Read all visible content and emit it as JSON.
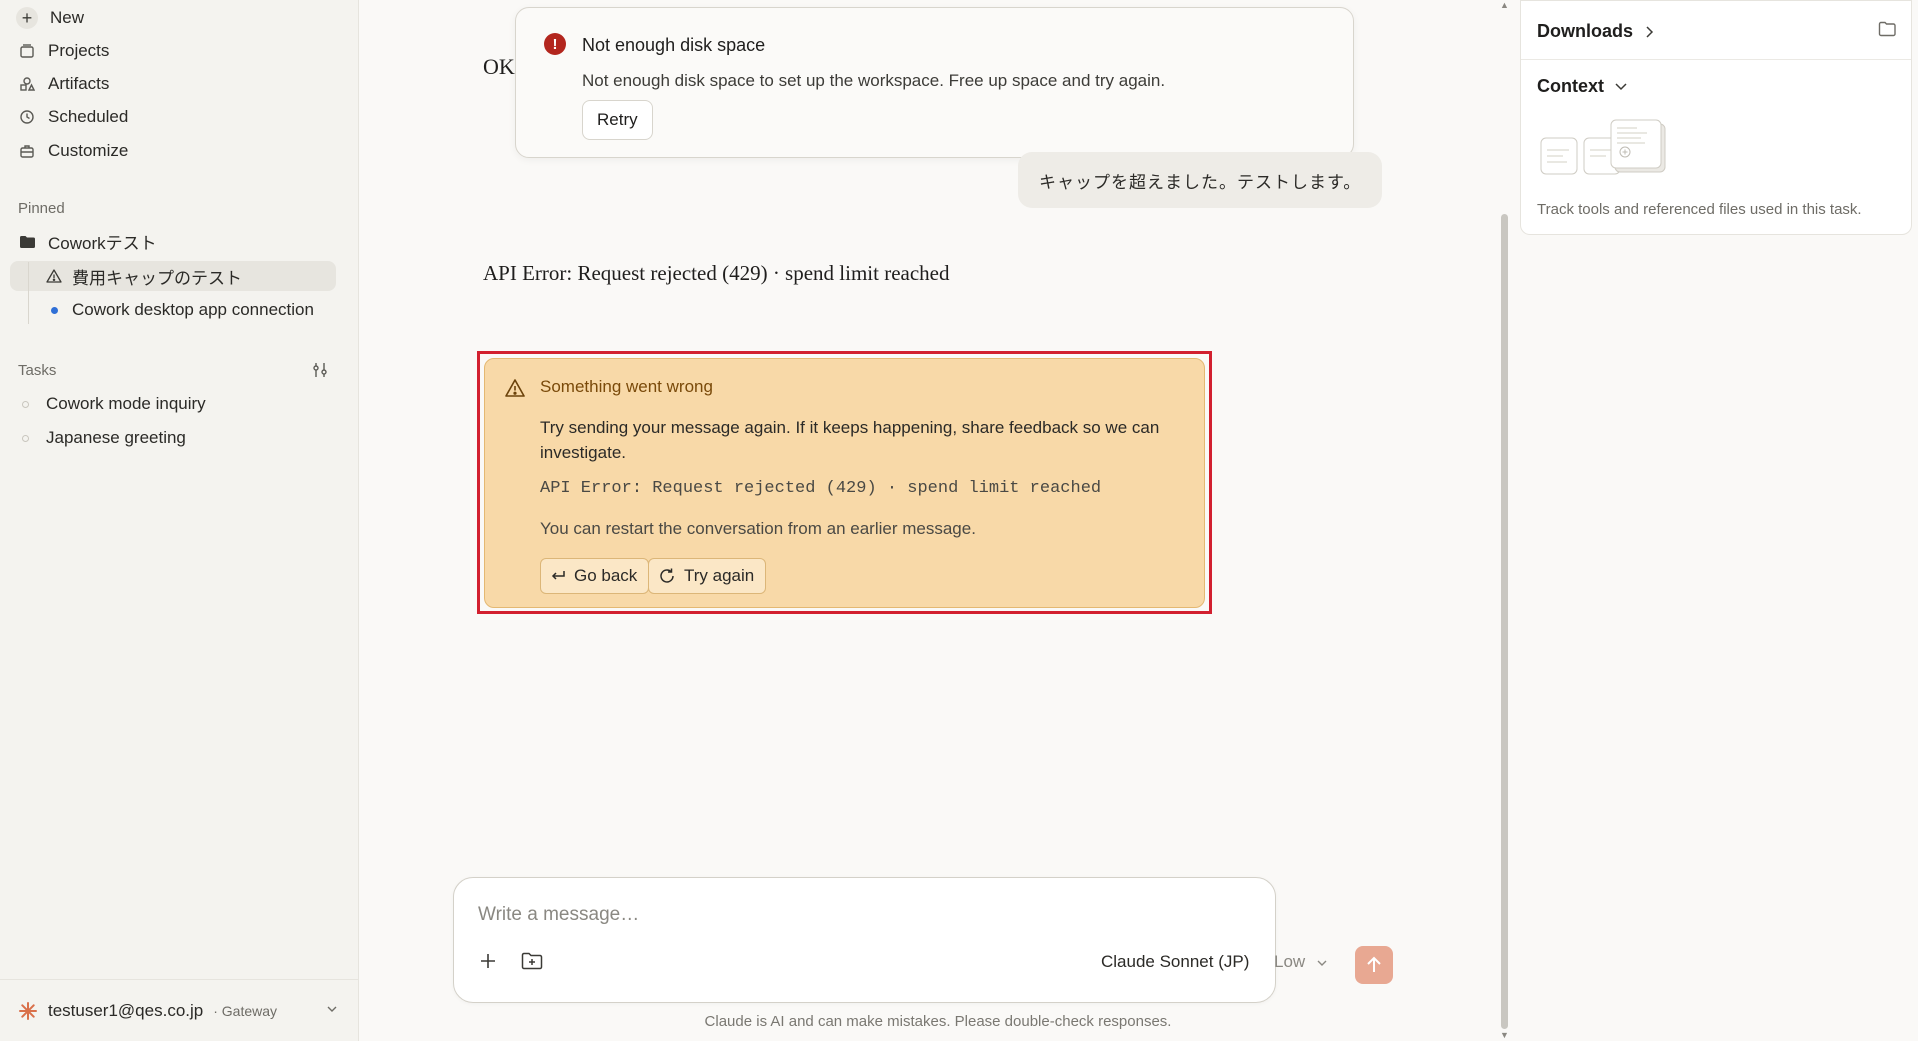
{
  "sidebar": {
    "nav": [
      {
        "label": "New",
        "icon": "plus-icon"
      },
      {
        "label": "Projects",
        "icon": "projects-icon"
      },
      {
        "label": "Artifacts",
        "icon": "artifacts-icon"
      },
      {
        "label": "Scheduled",
        "icon": "clock-icon"
      },
      {
        "label": "Customize",
        "icon": "briefcase-icon"
      }
    ],
    "pinned_label": "Pinned",
    "pinned_project": "Coworkテスト",
    "pinned_items": [
      {
        "label": "費用キャップのテスト",
        "icon": "warning-icon",
        "active": true
      },
      {
        "label": "Cowork desktop app connection",
        "icon": "dot-icon",
        "active": false
      }
    ],
    "tasks_label": "Tasks",
    "tasks": [
      {
        "label": "Cowork mode inquiry"
      },
      {
        "label": "Japanese greeting"
      }
    ],
    "user": {
      "email": "testuser1@qes.co.jp",
      "suffix": "· Gateway"
    }
  },
  "main": {
    "ok_text": "OK",
    "toast": {
      "title": "Not enough disk space",
      "body": "Not enough disk space to set up the workspace. Free up space and try again.",
      "retry_label": "Retry"
    },
    "user_message": "キャップを超えました。テストします。",
    "api_error_line": "API Error: Request rejected (429) · spend limit reached",
    "error_card": {
      "title": "Something went wrong",
      "body": "Try sending your message again. If it keeps happening, share feedback so we can investigate.",
      "code": "API Error: Request rejected (429) · spend limit reached",
      "note": "You can restart the conversation from an earlier message.",
      "go_back_label": "Go back",
      "try_again_label": "Try again"
    },
    "composer": {
      "placeholder": "Write a message…",
      "model": "Claude Sonnet (JP)",
      "effort": "Low"
    },
    "disclaimer": "Claude is AI and can make mistakes. Please double-check responses."
  },
  "right_panel": {
    "downloads_label": "Downloads",
    "context_label": "Context",
    "context_note": "Track tools and referenced files used in this task."
  },
  "colors": {
    "accent_send": "#e8a892",
    "error_card_bg": "#f8d9a8",
    "highlight_border": "#d2202f",
    "toast_error_icon": "#b3261e"
  }
}
